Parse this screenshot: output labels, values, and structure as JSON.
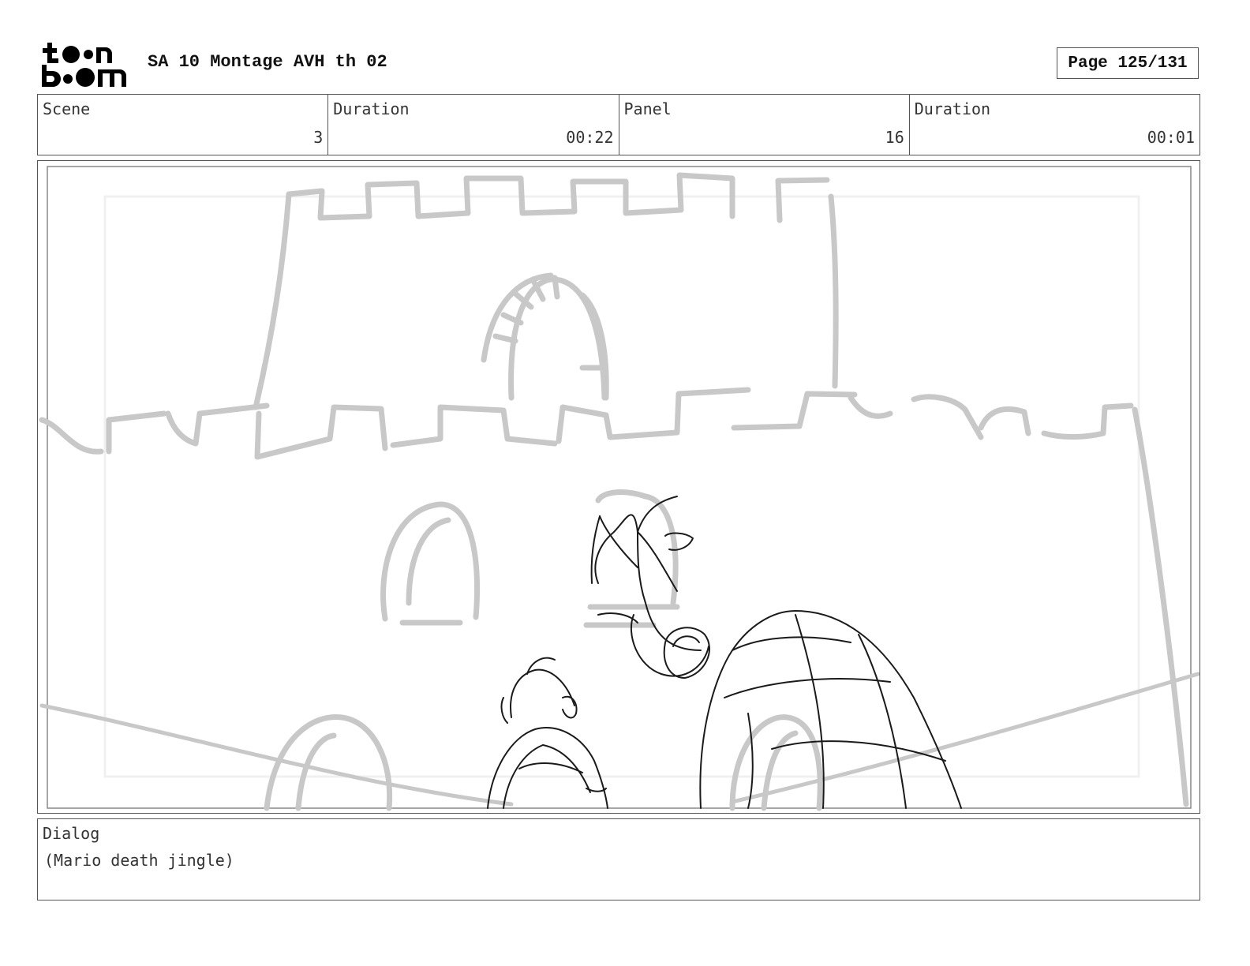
{
  "header": {
    "logo_text": "toon boom",
    "title": "SA 10 Montage AVH th 02",
    "page": "Page 125/131"
  },
  "info": {
    "scene_label": "Scene",
    "scene_value": "3",
    "scene_duration_label": "Duration",
    "scene_duration_value": "00:22",
    "panel_label": "Panel",
    "panel_value": "16",
    "panel_duration_label": "Duration",
    "panel_duration_value": "00:01"
  },
  "dialog": {
    "label": "Dialog",
    "text": "(Mario death jingle)"
  }
}
